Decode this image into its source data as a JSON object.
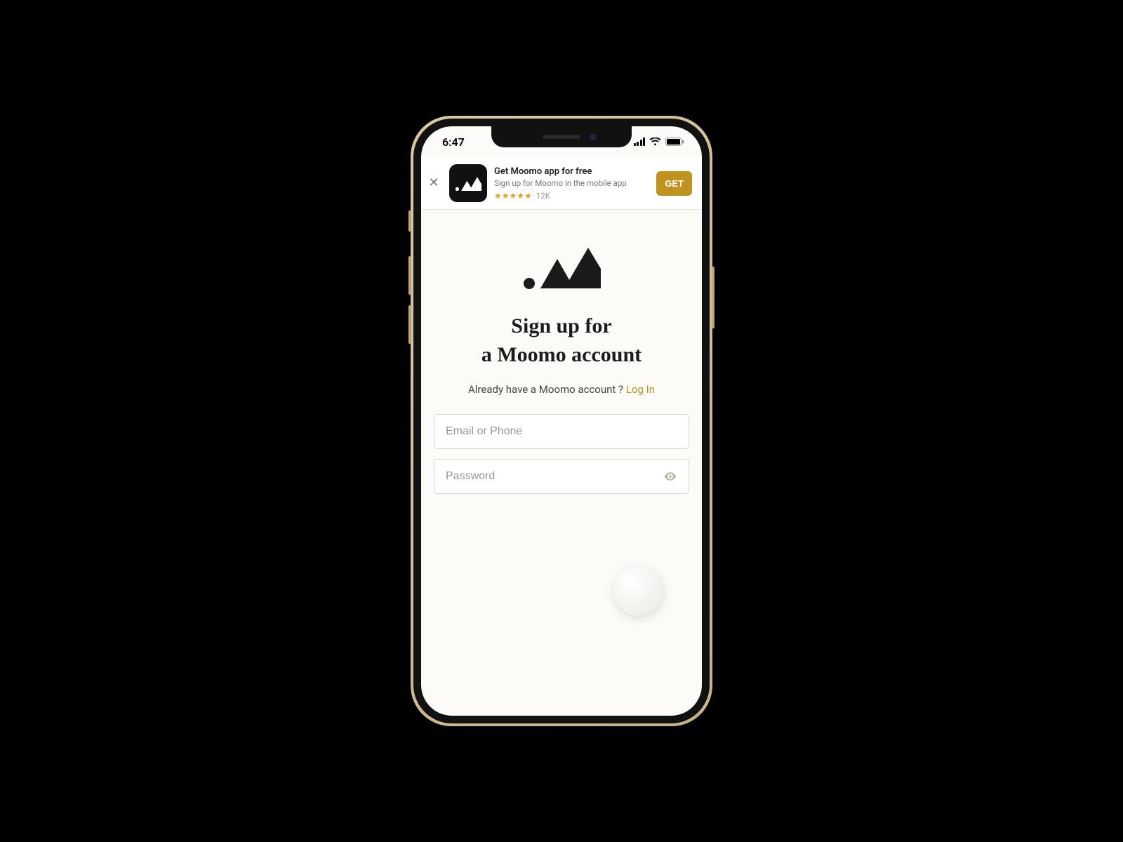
{
  "status": {
    "time": "6:47"
  },
  "banner": {
    "title": "Get Moomo app for free",
    "subtitle": "Sign up for Moomo in the mobile app",
    "rating_count": "12K",
    "cta": "GET",
    "close_glyph": "✕"
  },
  "page": {
    "headline_line1": "Sign up for",
    "headline_line2": "a Moomo account",
    "already_prefix": "Already have a Moomo account ? ",
    "login_label": "Log In"
  },
  "form": {
    "email_placeholder": "Email or Phone",
    "password_placeholder": "Password"
  },
  "colors": {
    "accent": "#c0921f"
  }
}
